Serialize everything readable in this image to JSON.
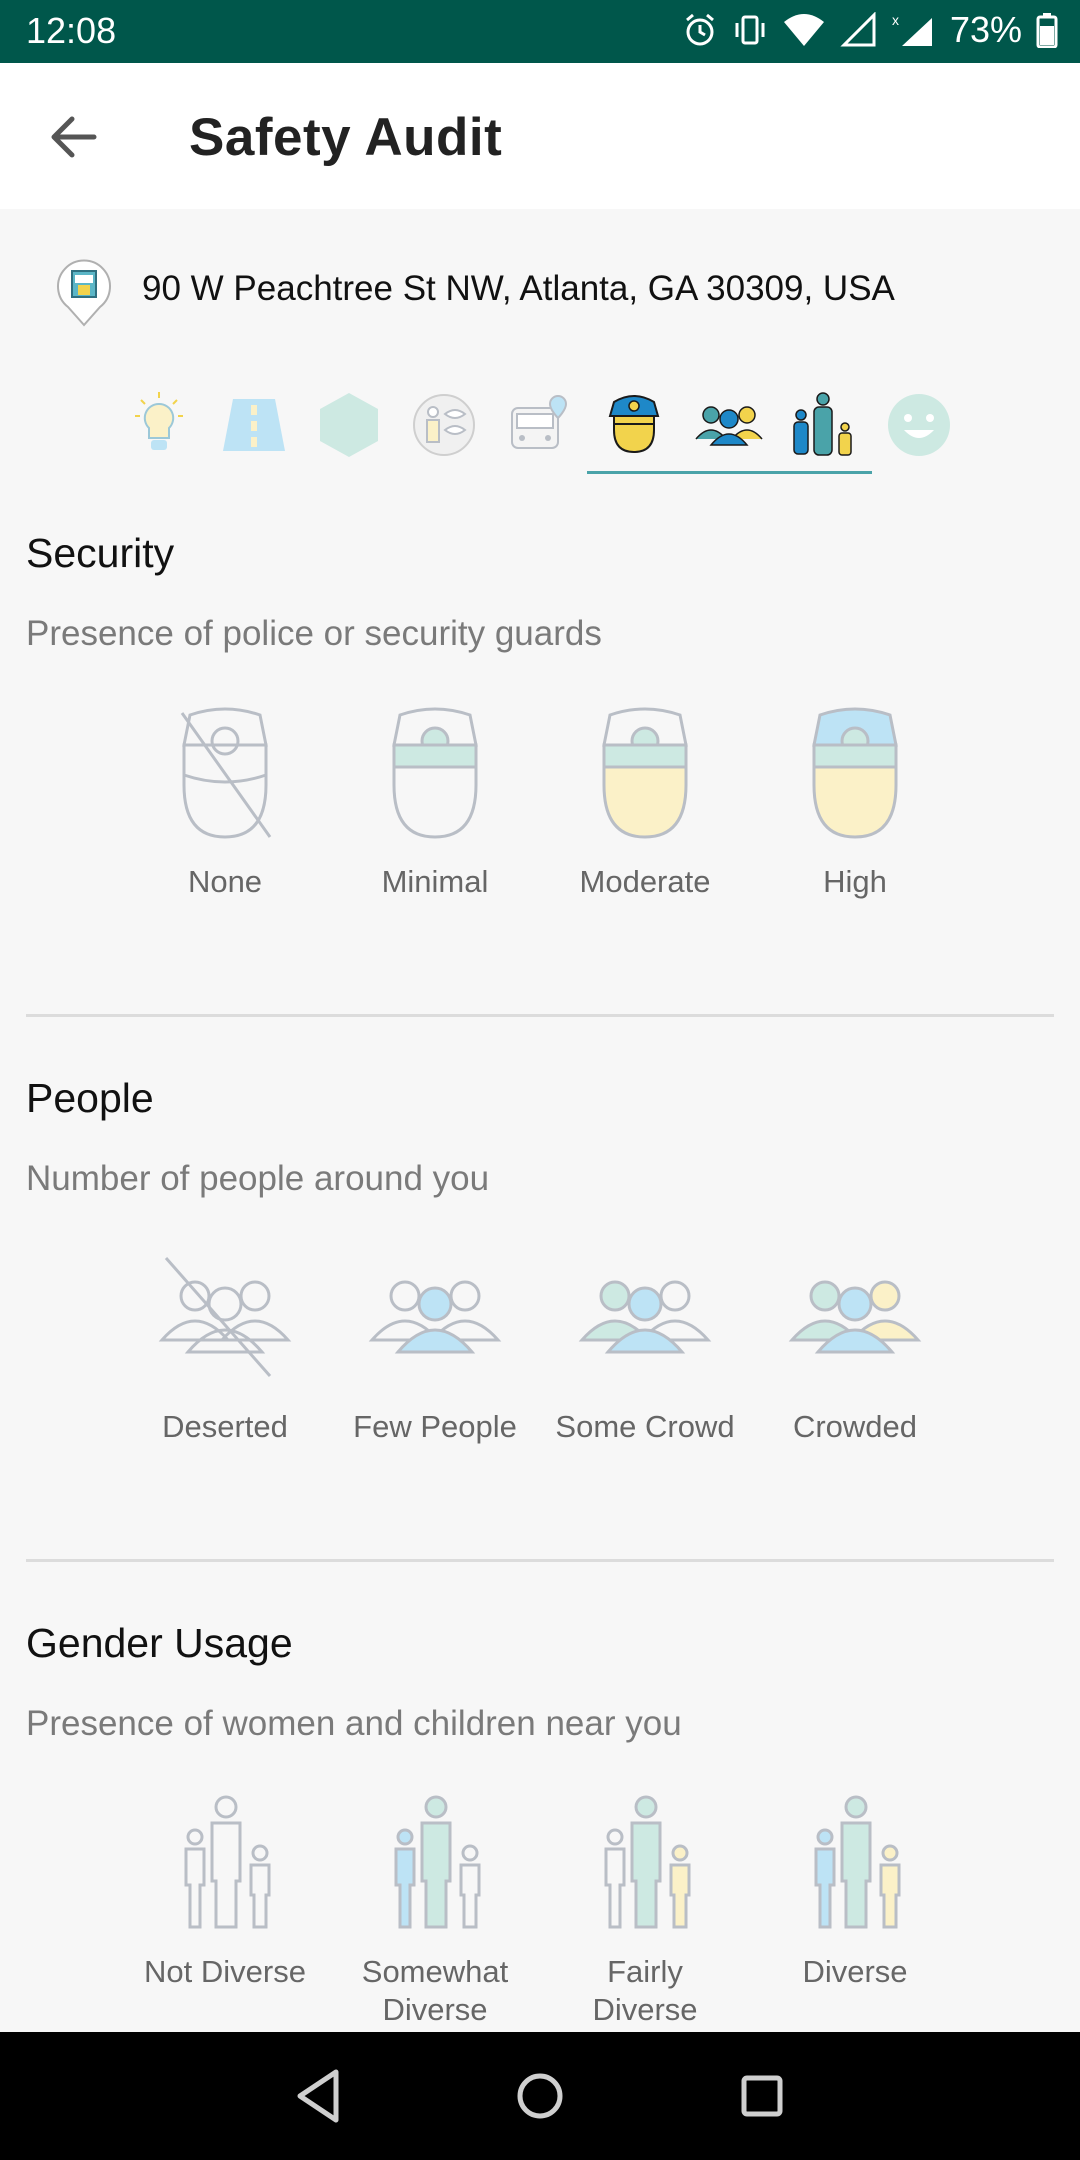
{
  "status_bar": {
    "time": "12:08",
    "battery": "73%"
  },
  "app_bar": {
    "title": "Safety Audit"
  },
  "location": {
    "address": "90 W Peachtree St NW, Atlanta, GA 30309, USA"
  },
  "category_tabs": [
    {
      "icon": "lightbulb-icon"
    },
    {
      "icon": "walkpath-icon"
    },
    {
      "icon": "hexagon-icon"
    },
    {
      "icon": "visibility-icon"
    },
    {
      "icon": "transport-icon"
    },
    {
      "icon": "security-icon",
      "selected": true
    },
    {
      "icon": "people-icon",
      "selected": true
    },
    {
      "icon": "gender-usage-icon",
      "selected": true
    },
    {
      "icon": "feeling-icon"
    }
  ],
  "sections": {
    "security": {
      "title": "Security",
      "description": "Presence of police or security guards",
      "options": [
        "None",
        "Minimal",
        "Moderate",
        "High"
      ]
    },
    "people": {
      "title": "People",
      "description": "Number of people around you",
      "options": [
        "Deserted",
        "Few People",
        "Some Crowd",
        "Crowded"
      ]
    },
    "gender_usage": {
      "title": "Gender Usage",
      "description": "Presence of women and children near you",
      "options": [
        "Not Diverse",
        "Somewhat\nDiverse",
        "Fairly\nDiverse",
        "Diverse"
      ]
    }
  },
  "colors": {
    "status_bar": "#00574B",
    "accent": "#4AA3A9",
    "light_blue": "#BDE3F5",
    "mint": "#CDE9E2",
    "cream": "#FBF1C8",
    "outline": "#B9BEC6"
  }
}
